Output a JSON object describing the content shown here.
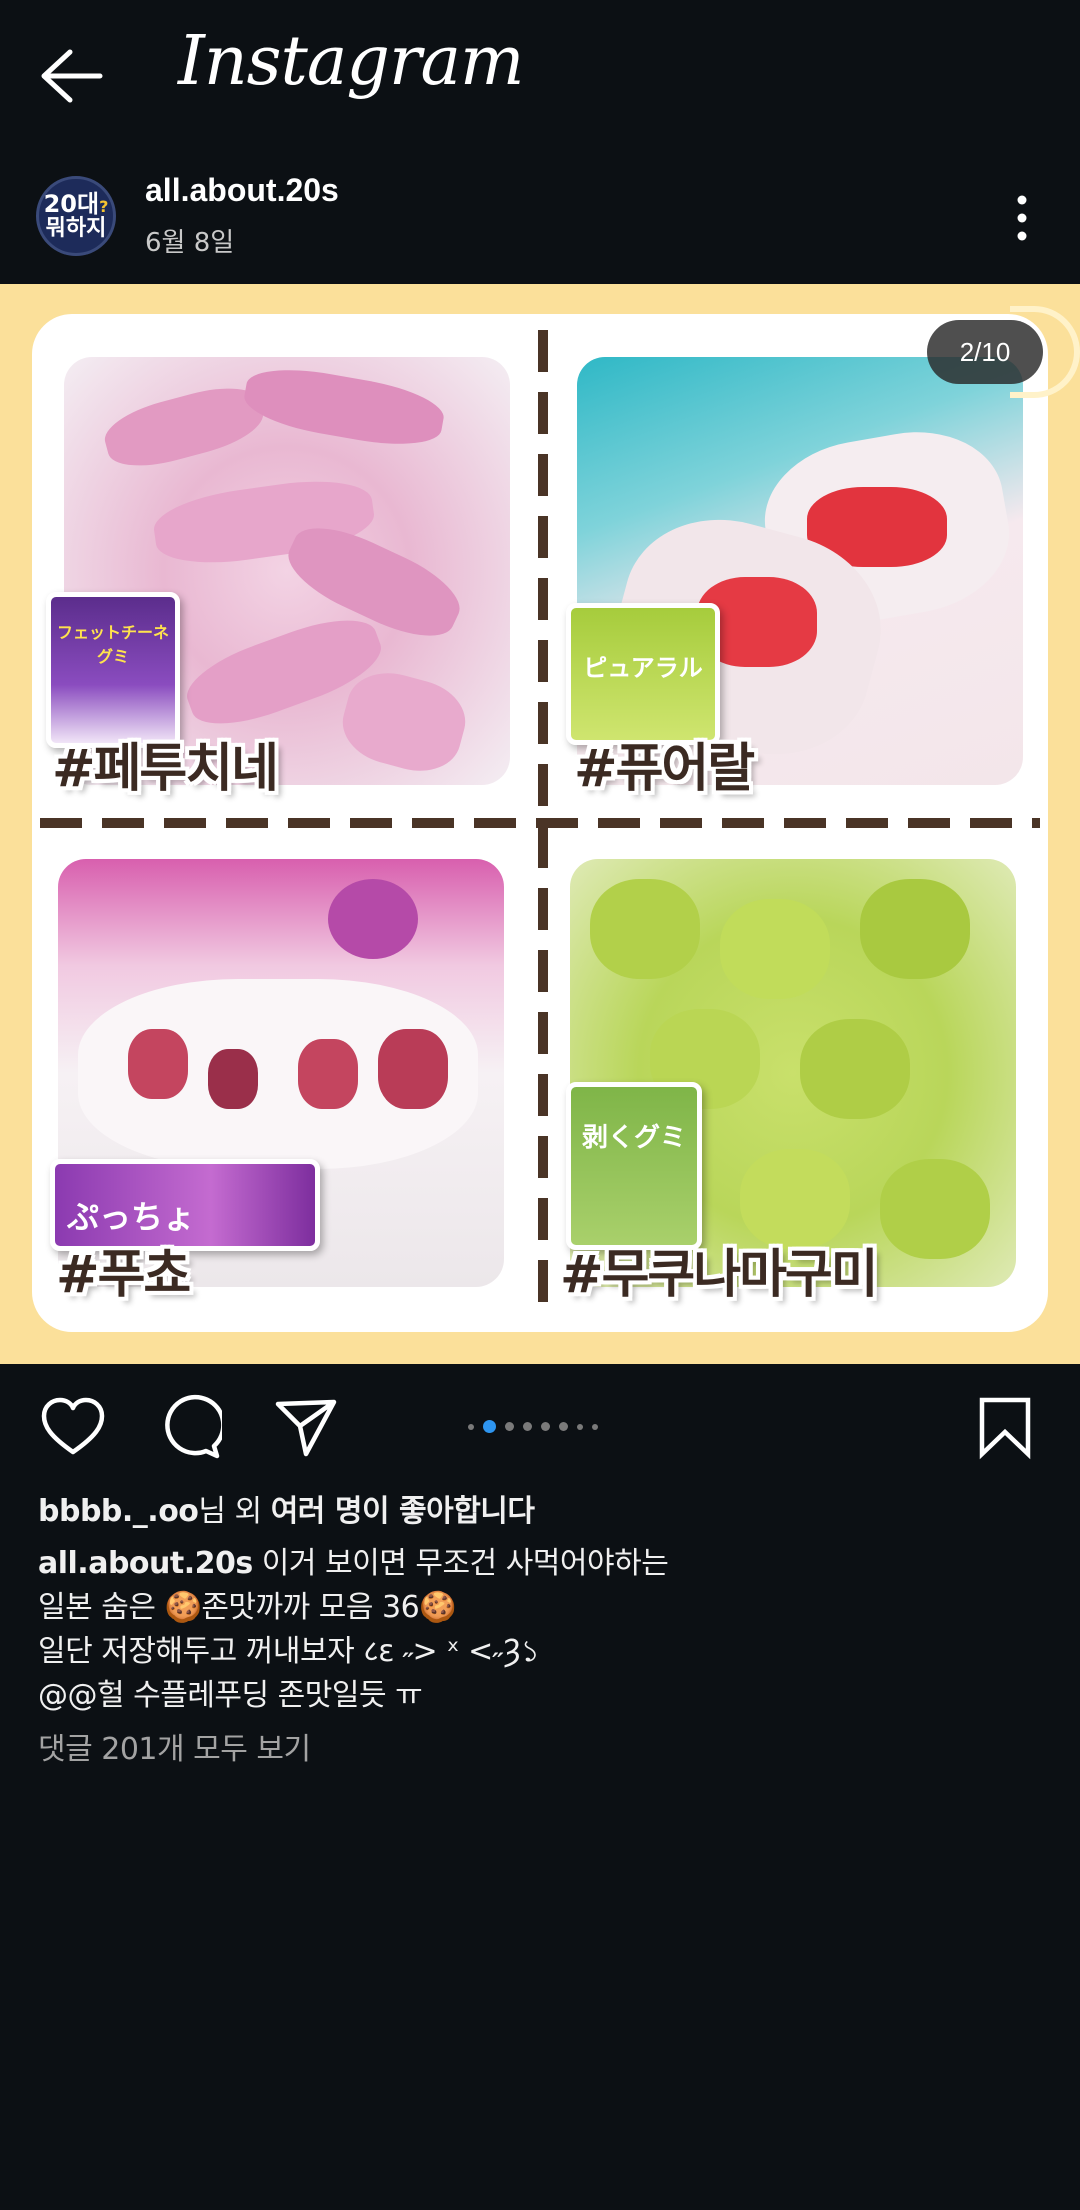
{
  "app": {
    "title": "Instagram"
  },
  "post": {
    "username": "all.about.20s",
    "date": "6월 8일",
    "avatar_text_top": "20대",
    "avatar_text_mark": "?",
    "avatar_text_bottom": "뭐하지",
    "carousel_counter": "2/10",
    "carousel": {
      "current": 2,
      "total": 10
    },
    "candies": [
      {
        "label": "#페투치네",
        "package_text": "フェットチーネグミ"
      },
      {
        "label": "#퓨어랄",
        "package_text": "ピュアラル"
      },
      {
        "label": "#푸쵸",
        "package_text": "ぷっちょ"
      },
      {
        "label": "#무쿠나마구미",
        "package_text": "剥くグミ"
      }
    ]
  },
  "likes": {
    "user": "bbbb._.oo",
    "suffix": "님 외 ",
    "rest": "여러 명이 좋아합니다"
  },
  "caption": {
    "username": "all.about.20s",
    "line1": " 이거 보이면 무조건 사먹어야하는",
    "line2": "일본 숨은 🍪존맛까까 모음 36🍪",
    "line3": "일단 저장해두고 꺼내보자 ८ε ˶> ˣ <˶Ȝ১",
    "line4": "@@헐 수플레푸딩 존맛일듯 ㅠ"
  },
  "comments_link": "댓글 201개 모두 보기",
  "icons": [
    "back-arrow-icon",
    "more-vertical-icon",
    "heart-icon",
    "comment-icon",
    "share-icon",
    "bookmark-icon"
  ],
  "colors": {
    "background": "#0c1014",
    "media_frame": "#fbe09a",
    "active_dot": "#2e95f0"
  }
}
